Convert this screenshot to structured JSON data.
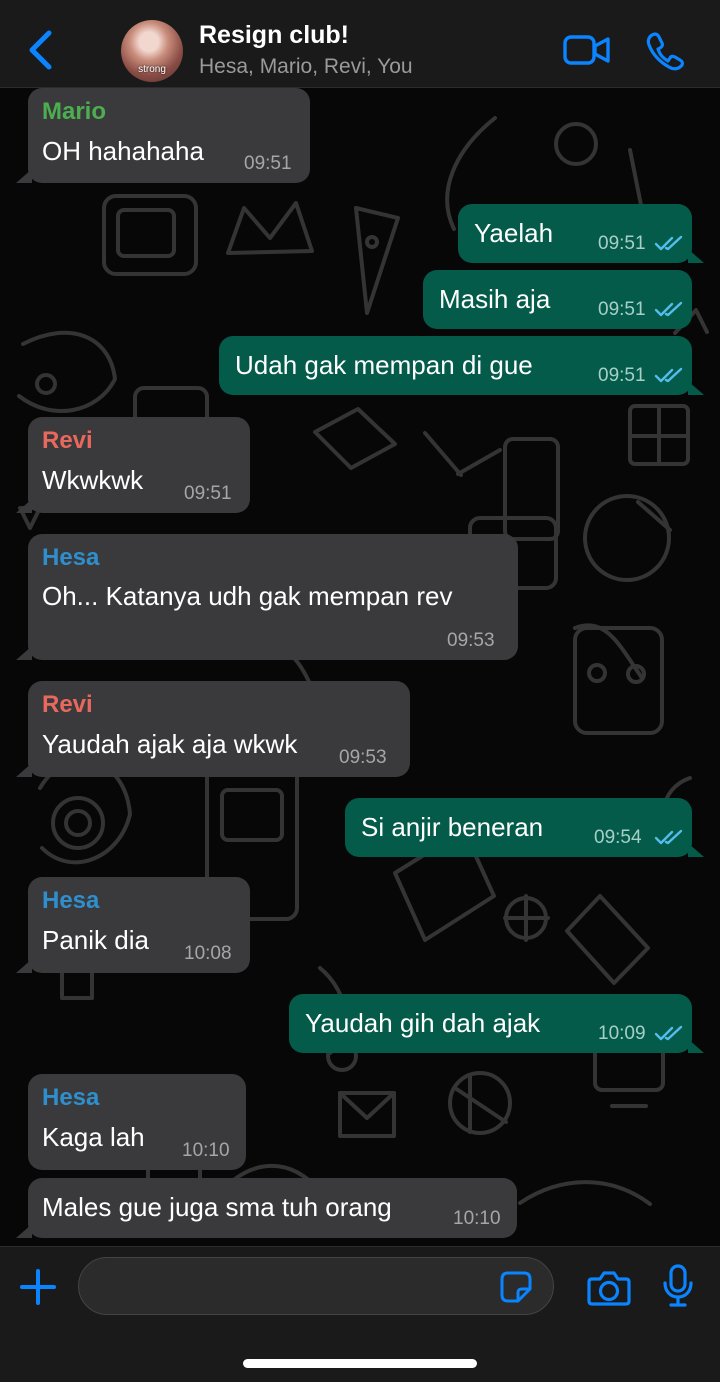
{
  "header": {
    "title": "Resign club!",
    "subtitle": "Hesa, Mario, Revi, You",
    "avatar_text": "strong"
  },
  "colors": {
    "accent": "#0a84ff",
    "mario": "#4cae50",
    "revi": "#e8685d",
    "hesa": "#2f8fcd",
    "incoming_bubble": "#3a3a3c",
    "outgoing_bubble": "#045b4a"
  },
  "messages": [
    {
      "direction": "in",
      "sender": "Mario",
      "text": "OH hahahaha",
      "time": "09:51"
    },
    {
      "direction": "out",
      "text": "Yaelah",
      "time": "09:51",
      "status": "read"
    },
    {
      "direction": "out",
      "text": "Masih aja",
      "time": "09:51",
      "status": "read"
    },
    {
      "direction": "out",
      "text": "Udah gak mempan di gue",
      "time": "09:51",
      "status": "read"
    },
    {
      "direction": "in",
      "sender": "Revi",
      "text": "Wkwkwk",
      "time": "09:51"
    },
    {
      "direction": "in",
      "sender": "Hesa",
      "text": "Oh... Katanya udh gak mempan rev",
      "time": "09:53"
    },
    {
      "direction": "in",
      "sender": "Revi",
      "text": "Yaudah ajak aja wkwk",
      "time": "09:53"
    },
    {
      "direction": "out",
      "text": "Si anjir beneran",
      "time": "09:54",
      "status": "read"
    },
    {
      "direction": "in",
      "sender": "Hesa",
      "text": "Panik dia",
      "time": "10:08"
    },
    {
      "direction": "out",
      "text": "Yaudah gih dah ajak",
      "time": "10:09",
      "status": "read"
    },
    {
      "direction": "in",
      "sender": "Hesa",
      "text": "Kaga lah",
      "time": "10:10"
    },
    {
      "direction": "in",
      "text": "Males gue juga sma tuh orang",
      "time": "10:10"
    }
  ],
  "composer": {
    "placeholder": ""
  },
  "icons": [
    "back-icon",
    "group-avatar",
    "video-call-icon",
    "phone-call-icon",
    "plus-icon",
    "sticker-icon",
    "camera-icon",
    "microphone-icon",
    "read-receipt-icon"
  ]
}
